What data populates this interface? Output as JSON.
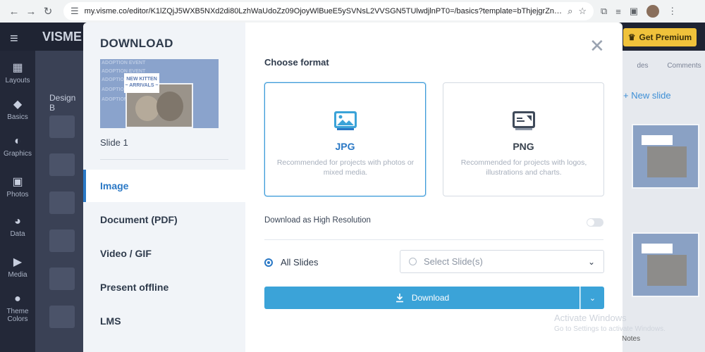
{
  "browser": {
    "url": "my.visme.co/editor/K1lZQjJ5WXB5NXd2di80LzhWaUdoZz09OjoyWlBueE5ySVNsL2VVSGN5TUlwdjlnPT0=/basics?template=bThjejgrZnBXQndrYkJUW..."
  },
  "app": {
    "logo": "VISME",
    "premium_label": "Get Premium"
  },
  "leftbar": {
    "items": [
      {
        "label": "Layouts"
      },
      {
        "label": "Basics"
      },
      {
        "label": "Graphics"
      },
      {
        "label": "Photos"
      },
      {
        "label": "Data"
      },
      {
        "label": "Media"
      },
      {
        "label": "Theme Colors"
      }
    ]
  },
  "panel2": {
    "title": "Design B"
  },
  "rightpanel": {
    "tab_slides": "des",
    "tab_comments": "Comments",
    "new_slide": "+ New slide",
    "notes": "Notes"
  },
  "windows_watermark": {
    "line1": "Activate Windows",
    "line2": "Go to Settings to activate Windows."
  },
  "modal": {
    "title": "DOWNLOAD",
    "preview_texts": [
      "ADOPTION EVENT",
      "ADOPTION EVENT",
      "ADOPTION EVE",
      "ADOPTION",
      "ADOPTION"
    ],
    "preview_tag": "NEW KITTEN\n~ ARRIVALS ~",
    "slide_name": "Slide 1",
    "menu": [
      {
        "label": "Image"
      },
      {
        "label": "Document (PDF)"
      },
      {
        "label": "Video / GIF"
      },
      {
        "label": "Present offline"
      },
      {
        "label": "LMS"
      }
    ],
    "choose_format": "Choose format",
    "formats": [
      {
        "name": "JPG",
        "desc": "Recommended for projects with photos or mixed media."
      },
      {
        "name": "PNG",
        "desc": "Recommended for projects with logos, illustrations and charts."
      }
    ],
    "high_res_label": "Download as High Resolution",
    "all_slides_label": "All Slides",
    "select_slides_placeholder": "Select Slide(s)",
    "download_label": "Download"
  }
}
